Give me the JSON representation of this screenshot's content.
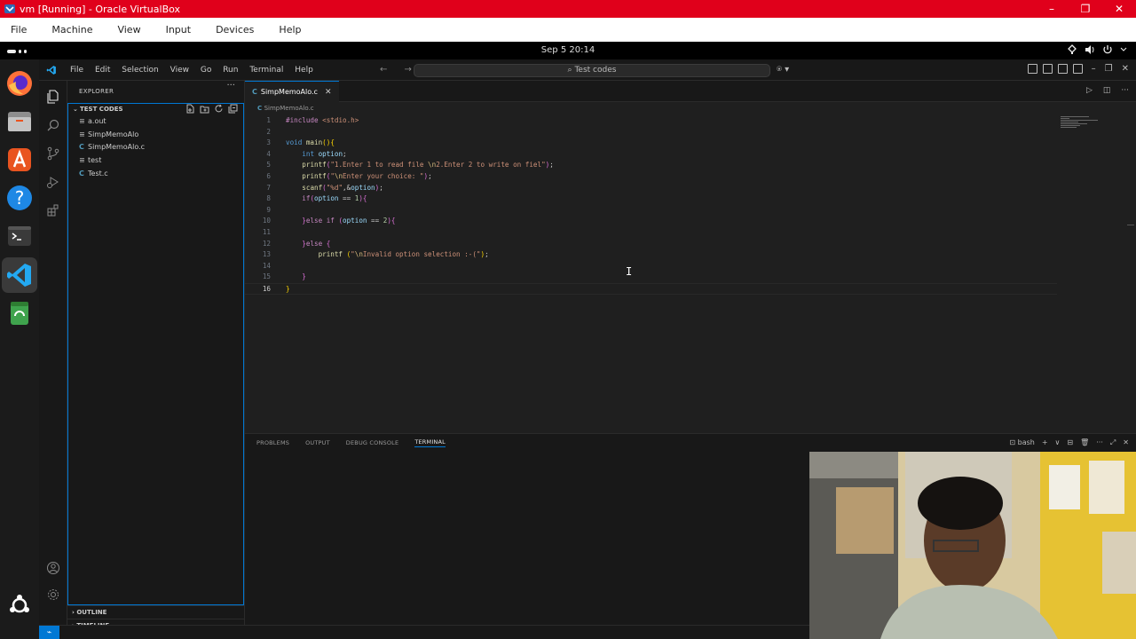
{
  "host_window": {
    "title": "vm [Running] - Oracle VirtualBox",
    "controls": [
      "–",
      "❐",
      "✕"
    ],
    "menu": [
      "File",
      "Machine",
      "View",
      "Input",
      "Devices",
      "Help"
    ]
  },
  "guest_topbar": {
    "clock": "Sep 5  20:14",
    "tray_icons": [
      "network-icon",
      "volume-icon",
      "power-icon",
      "chevron-down-icon"
    ]
  },
  "dock": {
    "apps": [
      "firefox",
      "files",
      "app-center",
      "help",
      "terminal",
      "vscode",
      "trash"
    ]
  },
  "vscode": {
    "menu": [
      "File",
      "Edit",
      "Selection",
      "View",
      "Go",
      "Run",
      "Terminal",
      "Help"
    ],
    "nav_arrows": "← →",
    "command_center": "Test codes",
    "explorer": {
      "header": "EXPLORER",
      "more": "···",
      "folder_name": "TEST CODES",
      "files": [
        {
          "type": "bin",
          "icon": "≡",
          "name": "a.out"
        },
        {
          "type": "bin",
          "icon": "≡",
          "name": "SimpMemoAlo"
        },
        {
          "type": "c",
          "icon": "C",
          "name": "SimpMemoAlo.c"
        },
        {
          "type": "bin",
          "icon": "≡",
          "name": "test"
        },
        {
          "type": "c",
          "icon": "C",
          "name": "Test.c"
        }
      ],
      "outline": "OUTLINE",
      "timeline": "TIMELINE"
    },
    "editor": {
      "tab_label": "SimpMemoAlo.c",
      "tab_icon": "C",
      "breadcrumb": "SimpMemoAlo.c",
      "current_line": 16,
      "lines": [
        [
          [
            "ctl",
            "#include "
          ],
          [
            "str",
            "<stdio.h>"
          ]
        ],
        [],
        [
          [
            "kw",
            "void "
          ],
          [
            "fn",
            "main"
          ],
          [
            "br2",
            "()"
          ],
          [
            "br2",
            "{"
          ]
        ],
        [
          [
            "t",
            "    "
          ],
          [
            "kw",
            "int "
          ],
          [
            "var",
            "option"
          ],
          [
            "t",
            ";"
          ]
        ],
        [
          [
            "t",
            "    "
          ],
          [
            "fn",
            "printf"
          ],
          [
            "br",
            "("
          ],
          [
            "str",
            "\"1.Enter 1 to read file "
          ],
          [
            "esc",
            "\\n"
          ],
          [
            "str",
            "2.Enter 2 to write on fiel\""
          ],
          [
            "br",
            ")"
          ],
          [
            "t",
            ";"
          ]
        ],
        [
          [
            "t",
            "    "
          ],
          [
            "fn",
            "printf"
          ],
          [
            "br",
            "("
          ],
          [
            "str",
            "\""
          ],
          [
            "esc",
            "\\n"
          ],
          [
            "str",
            "Enter your choice: \""
          ],
          [
            "br",
            ")"
          ],
          [
            "t",
            ";"
          ]
        ],
        [
          [
            "t",
            "    "
          ],
          [
            "fn",
            "scanf"
          ],
          [
            "br",
            "("
          ],
          [
            "str",
            "\"%d\""
          ],
          [
            "t",
            ",&"
          ],
          [
            "var",
            "option"
          ],
          [
            "br",
            ")"
          ],
          [
            "t",
            ";"
          ]
        ],
        [
          [
            "t",
            "    "
          ],
          [
            "ctl",
            "if"
          ],
          [
            "br",
            "("
          ],
          [
            "var",
            "option"
          ],
          [
            "t",
            " == "
          ],
          [
            "num",
            "1"
          ],
          [
            "br",
            ")"
          ],
          [
            "br",
            "{"
          ]
        ],
        [],
        [
          [
            "t",
            "    "
          ],
          [
            "br",
            "}"
          ],
          [
            "ctl",
            "else if "
          ],
          [
            "br",
            "("
          ],
          [
            "var",
            "option"
          ],
          [
            "t",
            " == "
          ],
          [
            "num",
            "2"
          ],
          [
            "br",
            ")"
          ],
          [
            "br",
            "{"
          ]
        ],
        [],
        [
          [
            "t",
            "    "
          ],
          [
            "br",
            "}"
          ],
          [
            "ctl",
            "else "
          ],
          [
            "br",
            "{"
          ]
        ],
        [
          [
            "t",
            "        "
          ],
          [
            "fn",
            "printf"
          ],
          [
            "t",
            " "
          ],
          [
            "br2",
            "("
          ],
          [
            "str",
            "\""
          ],
          [
            "esc",
            "\\n"
          ],
          [
            "str",
            "Invalid option selection :-(\""
          ],
          [
            "br2",
            ")"
          ],
          [
            "t",
            ";"
          ]
        ],
        [],
        [
          [
            "t",
            "    "
          ],
          [
            "br",
            "}"
          ]
        ],
        [
          [
            "br2",
            "}"
          ]
        ]
      ]
    },
    "panel": {
      "tabs": [
        "PROBLEMS",
        "OUTPUT",
        "DEBUG CONSOLE",
        "TERMINAL"
      ],
      "active_tab": "TERMINAL",
      "terminal_name": "bash",
      "actions": [
        "+",
        "∨",
        "⊟",
        "🗑",
        "···",
        "⤢",
        "✕"
      ]
    },
    "status_remote": "⌁"
  },
  "colors": {
    "virtualbox_red": "#e0001b",
    "vscode_accent": "#0078d4",
    "ubuntu_orange": "#e95420"
  }
}
